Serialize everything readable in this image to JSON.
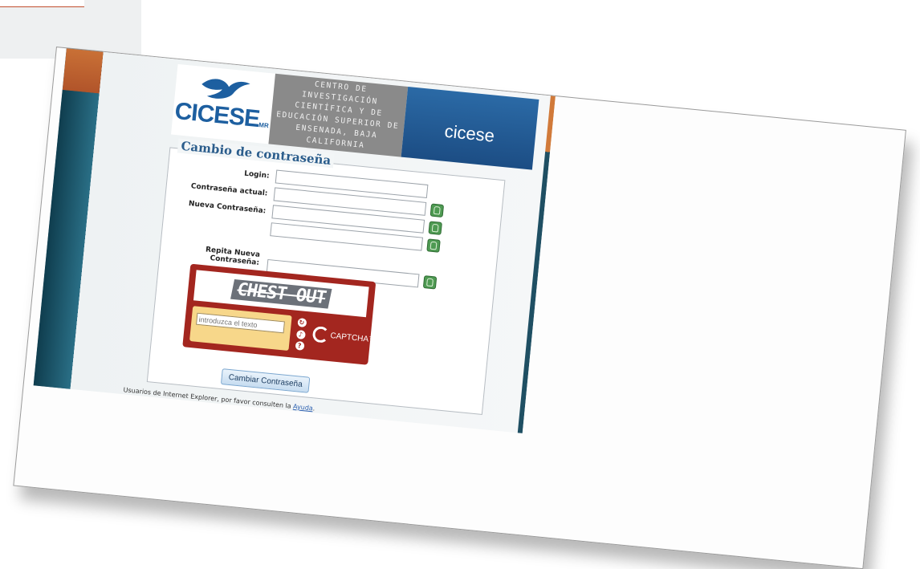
{
  "header": {
    "logo_text": "CICESE",
    "logo_suffix": "MR",
    "description": "CENTRO DE INVESTIGACIÓN CIENTÍFICA Y DE EDUCACIÓN SUPERIOR DE ENSENADA, BAJA CALIFORNIA",
    "brand": "cicese"
  },
  "form": {
    "legend": "Cambio de contraseña",
    "login_label": "Login:",
    "current_password_label": "Contraseña actual:",
    "new_password_label": "Nueva Contraseña:",
    "repeat_password_label": "Repita Nueva Contraseña:",
    "submit_label": "Cambiar Contraseña"
  },
  "captcha": {
    "word": "CHEST OUT",
    "input_placeholder": "introduzca el texto",
    "brand": "CAPTCHA™"
  },
  "footer": {
    "note": "Usuarios de Internet Explorer, por favor consulten la",
    "link": "Ayuda",
    "end": "."
  }
}
